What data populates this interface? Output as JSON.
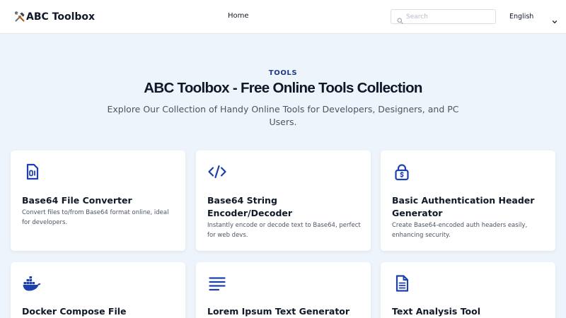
{
  "header": {
    "brand_name": "ABC Toolbox",
    "brand_icon": "tools-icon",
    "nav": [
      {
        "label": "Home"
      }
    ],
    "search": {
      "placeholder": "Search"
    },
    "language": {
      "selected": "English"
    }
  },
  "hero": {
    "eyebrow": "TOOLS",
    "title": "ABC Toolbox - Free Online Tools Collection",
    "subtitle": "Explore Our Collection of Handy Online Tools for Developers, Designers, and PC Users."
  },
  "tools": [
    {
      "title": "Base64 File Converter",
      "description": "Convert files to/from Base64 format online, ideal for developers.",
      "icon": "file-binary-icon"
    },
    {
      "title": "Base64 String Encoder/Decoder",
      "description": "Instantly encode or decode text to Base64, perfect for web devs.",
      "icon": "code-icon"
    },
    {
      "title": "Basic Authentication Header Generator",
      "description": "Create Base64-encoded auth headers easily, enhancing security.",
      "icon": "lock-icon"
    },
    {
      "title": "Docker Compose File",
      "description": "",
      "icon": "docker-icon"
    },
    {
      "title": "Lorem Ipsum Text Generator",
      "description": "",
      "icon": "text-lines-icon"
    },
    {
      "title": "Text Analysis Tool",
      "description": "",
      "icon": "document-icon"
    }
  ],
  "colors": {
    "accent": "#1e40af",
    "background": "#eef4fb",
    "card": "#ffffff"
  }
}
